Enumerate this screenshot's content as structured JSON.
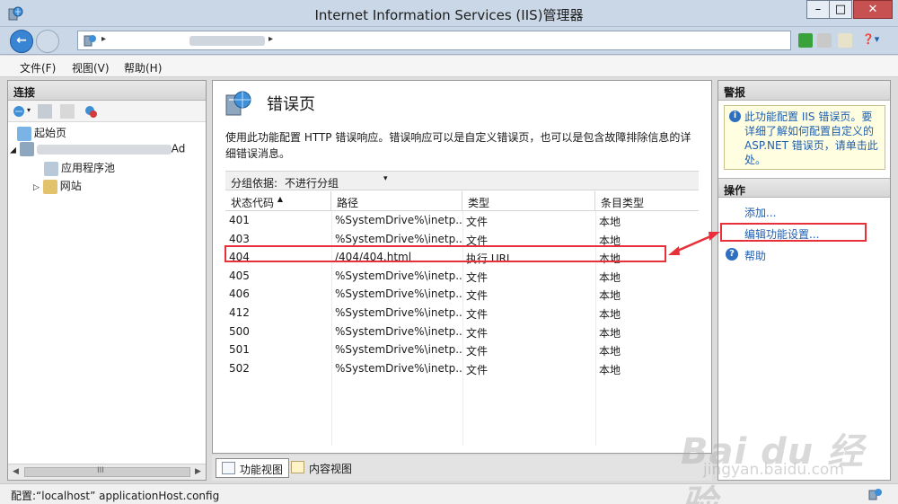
{
  "window": {
    "title": "Internet Information Services (IIS)管理器",
    "controls": {
      "minimize": "–",
      "maximize": "□",
      "close": "✕"
    }
  },
  "address": {
    "separator1": "▸",
    "separator2": "▸",
    "help": "❓▾"
  },
  "menu": {
    "file": "文件(F)",
    "view": "视图(V)",
    "help": "帮助(H)"
  },
  "connections": {
    "header": "连接",
    "tree": {
      "start_page": "起始页",
      "server_suffix": "Ad",
      "app_pools": "应用程序池",
      "sites": "网站"
    },
    "scroll_mid": "III"
  },
  "feature": {
    "title": "错误页",
    "description": "使用此功能配置 HTTP 错误响应。错误响应可以是自定义错误页，也可以是包含故障排除信息的详细错误消息。",
    "group_label": "分组依据:",
    "group_value": "不进行分组",
    "columns": [
      "状态代码",
      "路径",
      "类型",
      "条目类型"
    ],
    "rows": [
      [
        "401",
        "%SystemDrive%\\inetp...",
        "文件",
        "本地"
      ],
      [
        "403",
        "%SystemDrive%\\inetp...",
        "文件",
        "本地"
      ],
      [
        "404",
        "/404/404.html",
        "执行 URL",
        "本地"
      ],
      [
        "405",
        "%SystemDrive%\\inetp...",
        "文件",
        "本地"
      ],
      [
        "406",
        "%SystemDrive%\\inetp...",
        "文件",
        "本地"
      ],
      [
        "412",
        "%SystemDrive%\\inetp...",
        "文件",
        "本地"
      ],
      [
        "500",
        "%SystemDrive%\\inetp...",
        "文件",
        "本地"
      ],
      [
        "501",
        "%SystemDrive%\\inetp...",
        "文件",
        "本地"
      ],
      [
        "502",
        "%SystemDrive%\\inetp...",
        "文件",
        "本地"
      ]
    ],
    "tabs": {
      "features_view": "功能视图",
      "content_view": "内容视图"
    }
  },
  "actions": {
    "alert_header": "警报",
    "alert_text": "此功能配置 IIS 错误页。要详细了解如何配置自定义的 ASP.NET 错误页，请单击此处。",
    "header": "操作",
    "add": "添加...",
    "edit_settings": "编辑功能设置...",
    "help": "帮助"
  },
  "status": {
    "text": "配置:“localhost” applicationHost.config"
  },
  "watermark": {
    "brand": "Bai du 经验",
    "url": "jingyan.baidu.com"
  },
  "colors": {
    "highlight": "#e8303a",
    "link": "#1f5fb0",
    "accent": "#3a84d4"
  }
}
